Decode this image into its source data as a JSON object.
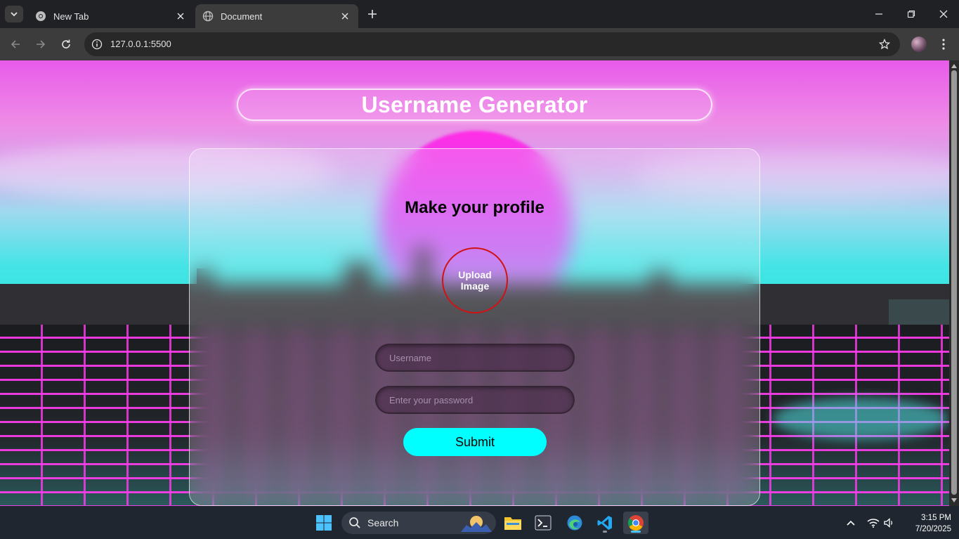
{
  "browser": {
    "tabs": [
      {
        "title": "New Tab",
        "active": false
      },
      {
        "title": "Document",
        "active": true
      }
    ],
    "url": "127.0.0.1:5500"
  },
  "page": {
    "title": "Username Generator",
    "card_title": "Make your profile",
    "upload_label": "Upload Image",
    "username_placeholder": "Username",
    "password_placeholder": "Enter your password",
    "submit_label": "Submit",
    "colors": {
      "submit_bg": "#00ffff",
      "upload_border": "#d11212"
    }
  },
  "taskbar": {
    "search_label": "Search",
    "time": "3:15 PM",
    "date": "7/20/2025"
  }
}
